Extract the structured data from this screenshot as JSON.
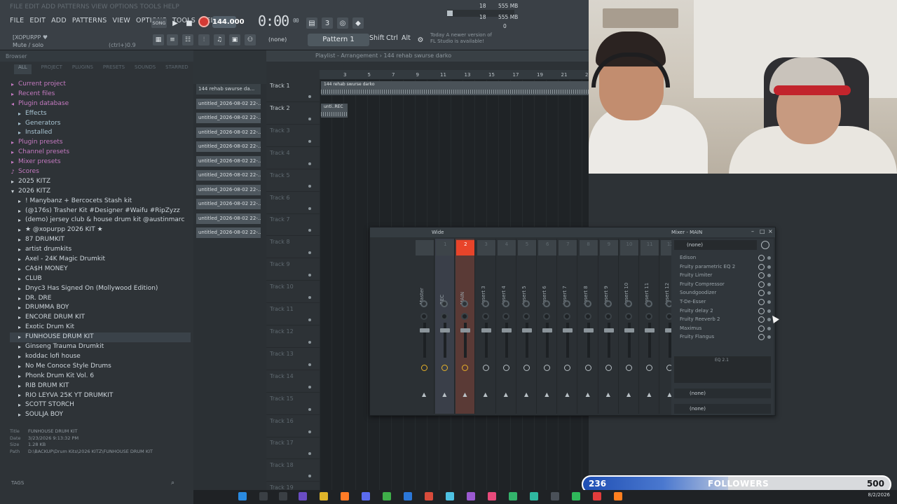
{
  "menu": {
    "items": [
      "FILE",
      "EDIT",
      "ADD",
      "PATTERNS",
      "VIEW",
      "OPTIONS",
      "TOOLS",
      "HELP"
    ]
  },
  "transport": {
    "song_label": "SONG",
    "tempo": "144.000",
    "time": "0:00",
    "time_sub": "00",
    "stat1": "18",
    "stat2": "555 MB",
    "stat3": "18",
    "stat4": "555 MB",
    "stat5": "0"
  },
  "hint": {
    "user": "[XOPURPP ♥",
    "mode": "Mute / solo",
    "shortcut": "(ctrl+)0.9"
  },
  "toolbar": {
    "pattern_select": "(none)",
    "pattern": "Pattern 1",
    "mod_shift": "Shift",
    "mod_ctrl": "Ctrl",
    "mod_alt": "Alt",
    "news": "Today  A newer version of FL Studio is available!"
  },
  "browser": {
    "title": "Browser",
    "tabs": [
      "ALL",
      "PROJECT",
      "PLUGINS",
      "PRESETS",
      "SOUNDS",
      "STARRED"
    ],
    "categories": [
      {
        "label": "Current project",
        "type": "cat",
        "icon": "▸"
      },
      {
        "label": "Recent files",
        "type": "cat",
        "icon": "▸"
      },
      {
        "label": "Plugin database",
        "type": "cat",
        "icon": "◂"
      },
      {
        "label": "Effects",
        "type": "sub",
        "icon": "▸"
      },
      {
        "label": "Generators",
        "type": "sub",
        "icon": "▸"
      },
      {
        "label": "Installed",
        "type": "sub",
        "icon": "▸"
      },
      {
        "label": "Plugin presets",
        "type": "cat",
        "icon": "▸"
      },
      {
        "label": "Channel presets",
        "type": "cat",
        "icon": "▸"
      },
      {
        "label": "Mixer presets",
        "type": "cat",
        "icon": "▸"
      },
      {
        "label": "Scores",
        "type": "cat",
        "icon": "♪"
      },
      {
        "label": "2025 KITZ",
        "type": "folder",
        "icon": "▸"
      },
      {
        "label": "2026 KITZ",
        "type": "folder",
        "icon": "▾"
      },
      {
        "label": "! Manybanz + Bercocets Stash kit",
        "type": "kit",
        "icon": "▸"
      },
      {
        "label": "(@176s) Trasher Kit #Designer #Waifu #RipZyzz",
        "type": "kit",
        "icon": "▸"
      },
      {
        "label": "(demo) jersey club & house drum kit @austinmarc",
        "type": "kit",
        "icon": "▸"
      },
      {
        "label": "★ @xopurpp 2026 KIT ★",
        "type": "kit",
        "icon": "▸"
      },
      {
        "label": "87 DRUMKIT",
        "type": "kit",
        "icon": "▸"
      },
      {
        "label": "artist drumkits",
        "type": "kit",
        "icon": "▸"
      },
      {
        "label": "Axel - 24K Magic Drumkit",
        "type": "kit",
        "icon": "▸"
      },
      {
        "label": "CA$H MONEY",
        "type": "kit",
        "icon": "▸"
      },
      {
        "label": "CLUB",
        "type": "kit",
        "icon": "▸"
      },
      {
        "label": "Dnyc3 Has Signed On (Mollywood Edition)",
        "type": "kit",
        "icon": "▸"
      },
      {
        "label": "DR. DRE",
        "type": "kit",
        "icon": "▸"
      },
      {
        "label": "DRUMMA BOY",
        "type": "kit",
        "icon": "▸"
      },
      {
        "label": "ENCORE DRUM KIT",
        "type": "kit",
        "icon": "▸"
      },
      {
        "label": "Exotic Drum Kit",
        "type": "kit",
        "icon": "▸"
      },
      {
        "label": "FUNHOUSE DRUM KIT",
        "type": "kit",
        "icon": "▸",
        "selected": true
      },
      {
        "label": "Ginseng Trauma Drumkit",
        "type": "kit",
        "icon": "▸"
      },
      {
        "label": "koddac lofi house",
        "type": "kit",
        "icon": "▸"
      },
      {
        "label": "No Me Conoce Style Drums",
        "type": "kit",
        "icon": "▸"
      },
      {
        "label": "Phonk Drum Kit Vol. 6",
        "type": "kit",
        "icon": "▸"
      },
      {
        "label": "RIB DRUM KIT",
        "type": "kit",
        "icon": "▸"
      },
      {
        "label": "RIO LEYVA 25K YT DRUMKIT",
        "type": "kit",
        "icon": "▸"
      },
      {
        "label": "SCOTT STORCH",
        "type": "kit",
        "icon": "▸"
      },
      {
        "label": "SOULJA BOY",
        "type": "kit",
        "icon": "▸"
      }
    ],
    "meta": {
      "title_key": "Title",
      "title": "FUNHOUSE DRUM KIT",
      "date_key": "Date",
      "date": "3/23/2026 9:13:32 PM",
      "size_key": "Size",
      "size": "1.28 KB",
      "path_key": "Path",
      "path": "D:\\BACKUP\\Drum Kits\\2026 KITZ\\FUNHOUSE DRUM KIT"
    },
    "tags": "TAGS"
  },
  "patterns": {
    "items": [
      "144 rehab swurse da...",
      "untitled_2026-08-02 22-...",
      "untitled_2026-08-02 22-...",
      "untitled_2026-08-02 22-...",
      "untitled_2026-08-02 22-...",
      "untitled_2026-08-02 22-...",
      "untitled_2026-08-02 22-...",
      "untitled_2026-08-02 22-...",
      "untitled_2026-08-02 22-...",
      "untitled_2026-08-02 22-...",
      "untitled_2026-08-02 22-..."
    ]
  },
  "playlist": {
    "title": "Playlist - Arrangement  ›  144 rehab swurse darko",
    "ruler": [
      "3",
      "5",
      "7",
      "9",
      "11",
      "13",
      "15",
      "17",
      "19",
      "21",
      "23"
    ],
    "tracks": [
      "Track 1",
      "Track 2",
      "Track 3",
      "Track 4",
      "Track 5",
      "Track 6",
      "Track 7",
      "Track 8",
      "Track 9",
      "Track 10",
      "Track 11",
      "Track 12",
      "Track 13",
      "Track 14",
      "Track 15",
      "Track 16",
      "Track 17",
      "Track 18",
      "Track 19"
    ],
    "clip1": "144 rehab swurse darko",
    "clip2": "unti..REC"
  },
  "mixer": {
    "mode": "Wide",
    "title": "Mixer - MAIN",
    "strips": [
      {
        "num": "",
        "label": "Master"
      },
      {
        "num": "1",
        "label": "REC"
      },
      {
        "num": "2",
        "label": "MAIN"
      },
      {
        "num": "3",
        "label": "Insert 3"
      },
      {
        "num": "4",
        "label": "Insert 4"
      },
      {
        "num": "5",
        "label": "Insert 5"
      },
      {
        "num": "6",
        "label": "Insert 6"
      },
      {
        "num": "7",
        "label": "Insert 7"
      },
      {
        "num": "8",
        "label": "Insert 8"
      },
      {
        "num": "9",
        "label": "Insert 9"
      },
      {
        "num": "10",
        "label": "Insert 10"
      },
      {
        "num": "11",
        "label": "Insert 11"
      },
      {
        "num": "12",
        "label": "Insert 12"
      }
    ],
    "input": "(none)",
    "effects": [
      "Edison",
      "Fruity parametric EQ 2",
      "Fruity Limiter",
      "Fruity Compressor",
      "Soundgoodizer",
      "T-De-Esser",
      "Fruity delay 2",
      "Fruity Reeverb 2",
      "Maximus",
      "Fruity Flangus"
    ],
    "eq_label": "EQ 2.1",
    "output1": "(none)",
    "output2": "(none)"
  },
  "followers": {
    "current": "236",
    "label": "FOLLOWERS",
    "goal": "500",
    "progress": 0.472
  },
  "taskbar": {
    "time": "",
    "date": "8/2/2026"
  }
}
